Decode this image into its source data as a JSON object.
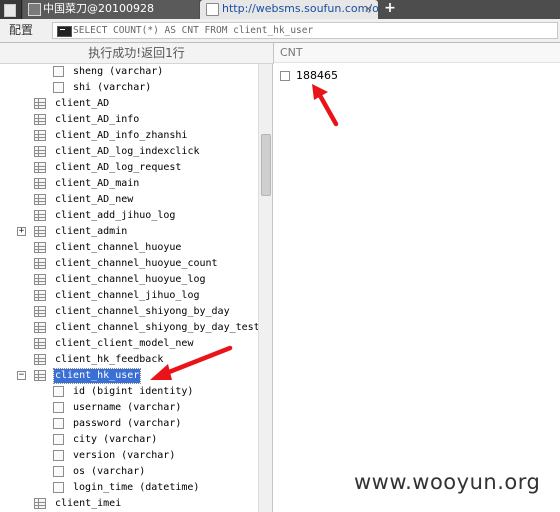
{
  "tabs": [
    {
      "label": "中国菜刀@20100928"
    },
    {
      "label": "http://websms.soufun.com/o...",
      "close": "×"
    }
  ],
  "new_tab": "+",
  "toolbar": {
    "config_label": "配置",
    "sql_query": "SELECT COUNT(*) AS CNT FROM client_hk_user"
  },
  "tree_panel": {
    "status": "执行成功!返回1行",
    "rows": [
      {
        "label": "sheng (varchar)",
        "kind": "field"
      },
      {
        "label": "shi (varchar)",
        "kind": "field"
      },
      {
        "label": "client_AD",
        "kind": "table"
      },
      {
        "label": "client_AD_info",
        "kind": "table"
      },
      {
        "label": "client_AD_info_zhanshi",
        "kind": "table"
      },
      {
        "label": "client_AD_log_indexclick",
        "kind": "table"
      },
      {
        "label": "client_AD_log_request",
        "kind": "table"
      },
      {
        "label": "client_AD_main",
        "kind": "table"
      },
      {
        "label": "client_AD_new",
        "kind": "table"
      },
      {
        "label": "client_add_jihuo_log",
        "kind": "table"
      },
      {
        "label": "client_admin",
        "kind": "table",
        "expander": "+"
      },
      {
        "label": "client_channel_huoyue",
        "kind": "table"
      },
      {
        "label": "client_channel_huoyue_count",
        "kind": "table"
      },
      {
        "label": "client_channel_huoyue_log",
        "kind": "table"
      },
      {
        "label": "client_channel_jihuo_log",
        "kind": "table"
      },
      {
        "label": "client_channel_shiyong_by_day",
        "kind": "table"
      },
      {
        "label": "client_channel_shiyong_by_day_test",
        "kind": "table"
      },
      {
        "label": "client_client_model_new",
        "kind": "table"
      },
      {
        "label": "client_hk_feedback",
        "kind": "table"
      },
      {
        "label": "client_hk_user",
        "kind": "table",
        "expander": "−",
        "selected": true
      },
      {
        "label": "id (bigint identity)",
        "kind": "field"
      },
      {
        "label": "username (varchar)",
        "kind": "field"
      },
      {
        "label": "password (varchar)",
        "kind": "field"
      },
      {
        "label": "city (varchar)",
        "kind": "field"
      },
      {
        "label": "version (varchar)",
        "kind": "field"
      },
      {
        "label": "os (varchar)",
        "kind": "field"
      },
      {
        "label": "login_time (datetime)",
        "kind": "field"
      },
      {
        "label": "client_imei",
        "kind": "table"
      }
    ]
  },
  "results": {
    "column": "CNT",
    "value": "188465"
  },
  "watermark": "www.wooyun.org",
  "colors": {
    "selection": "#3a6fd6",
    "annotation_arrow": "#e8141a",
    "tab_bar": "#4d4d4d"
  }
}
